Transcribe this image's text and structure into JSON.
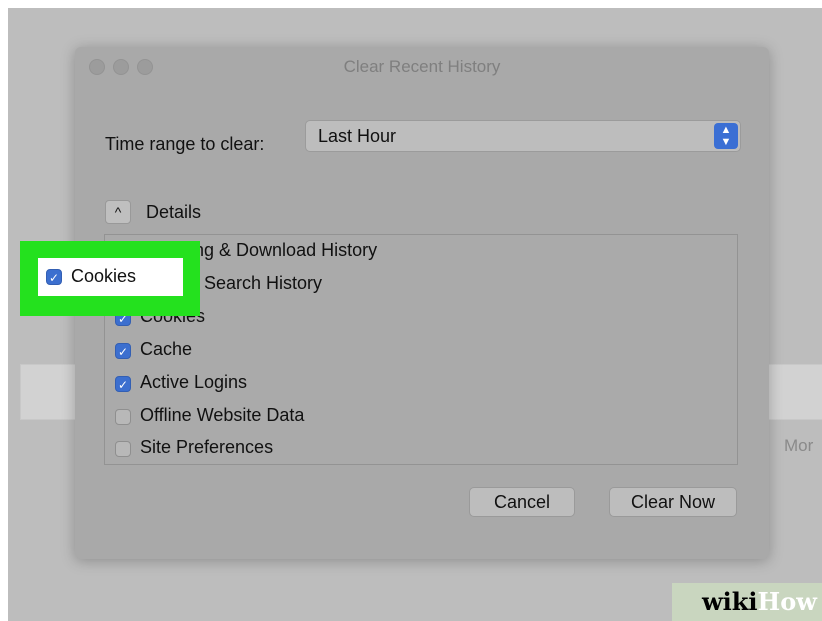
{
  "background": {
    "more_text": "Mor"
  },
  "dialog": {
    "title": "Clear Recent History",
    "time_range": {
      "label": "Time range to clear:",
      "value": "Last Hour",
      "stepper_icon": "up-down-chevron"
    },
    "details": {
      "toggle_icon": "chevron-up",
      "label": "Details"
    },
    "items": [
      {
        "label": "Browsing & Download History",
        "checked": true
      },
      {
        "label": "Form & Search History",
        "checked": true
      },
      {
        "label": "Cookies",
        "checked": true
      },
      {
        "label": "Cache",
        "checked": true
      },
      {
        "label": "Active Logins",
        "checked": true
      },
      {
        "label": "Offline Website Data",
        "checked": false
      },
      {
        "label": "Site Preferences",
        "checked": false
      }
    ],
    "buttons": {
      "cancel": "Cancel",
      "clear_now": "Clear Now"
    }
  },
  "highlight": {
    "color": "#24e11e",
    "target": "Cookies"
  },
  "watermark": {
    "wiki": "wiki",
    "how": "How"
  }
}
